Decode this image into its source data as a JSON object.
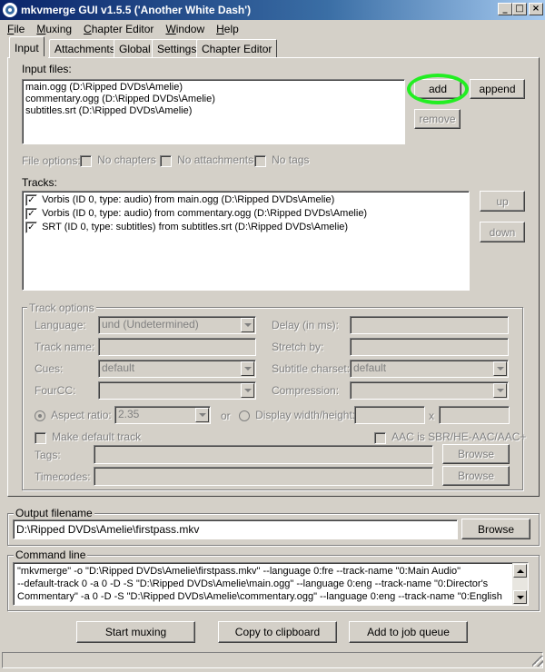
{
  "window": {
    "title": "mkvmerge GUI v1.5.5 ('Another White Dash')",
    "minimize_glyph": "_",
    "maximize_glyph": "□",
    "close_glyph": "×"
  },
  "menu": [
    "File",
    "Muxing",
    "Chapter Editor",
    "Window",
    "Help"
  ],
  "menu_accel": [
    "F",
    "M",
    "C",
    "W",
    "H"
  ],
  "tabs": [
    "Input",
    "Attachments",
    "Global",
    "Settings",
    "Chapter Editor"
  ],
  "active_tab": "Input",
  "input_files": {
    "label": "Input files:",
    "items": [
      "main.ogg (D:\\Ripped DVDs\\Amelie)",
      "commentary.ogg (D:\\Ripped DVDs\\Amelie)",
      "subtitles.srt (D:\\Ripped DVDs\\Amelie)"
    ],
    "add_label": "add",
    "append_label": "append",
    "remove_label": "remove"
  },
  "file_options": {
    "label": "File options:",
    "no_chapters": "No chapters",
    "no_attachments": "No attachments",
    "no_tags": "No tags"
  },
  "tracks": {
    "label": "Tracks:",
    "items": [
      {
        "checked": true,
        "text": "Vorbis (ID 0, type: audio) from main.ogg (D:\\Ripped DVDs\\Amelie)"
      },
      {
        "checked": true,
        "text": "Vorbis (ID 0, type: audio) from commentary.ogg (D:\\Ripped DVDs\\Amelie)"
      },
      {
        "checked": true,
        "text": "SRT (ID 0, type: subtitles) from subtitles.srt (D:\\Ripped DVDs\\Amelie)"
      }
    ],
    "up_label": "up",
    "down_label": "down"
  },
  "track_options": {
    "title": "Track options",
    "language_label": "Language:",
    "language_value": "und (Undetermined)",
    "delay_label": "Delay (in ms):",
    "track_name_label": "Track name:",
    "stretch_label": "Stretch by:",
    "cues_label": "Cues:",
    "cues_value": "default",
    "subtitle_charset_label": "Subtitle charset:",
    "subtitle_charset_value": "default",
    "fourcc_label": "FourCC:",
    "compression_label": "Compression:",
    "aspect_ratio_label": "Aspect ratio:",
    "aspect_ratio_value": "2.35",
    "or_label": "or",
    "display_wh_label": "Display width/height:",
    "x_label": "x",
    "make_default_label": "Make default track",
    "aac_label": "AAC is SBR/HE-AAC/AAC+",
    "tags_label": "Tags:",
    "timecodes_label": "Timecodes:",
    "browse_label": "Browse"
  },
  "output": {
    "title": "Output filename",
    "value": "D:\\Ripped DVDs\\Amelie\\firstpass.mkv",
    "browse_label": "Browse"
  },
  "command_line": {
    "title": "Command line",
    "lines": [
      "\"mkvmerge\" -o \"D:\\Ripped DVDs\\Amelie\\firstpass.mkv\"  --language 0:fre --track-name \"0:Main Audio\"",
      "--default-track 0 -a 0 -D -S \"D:\\Ripped DVDs\\Amelie\\main.ogg\" --language 0:eng --track-name \"0:Director's",
      "Commentary\" -a 0 -D -S \"D:\\Ripped DVDs\\Amelie\\commentary.ogg\" --language 0:eng --track-name \"0:English"
    ]
  },
  "actions": {
    "start_muxing": "Start muxing",
    "copy_clipboard": "Copy to clipboard",
    "add_job_queue": "Add to job queue"
  },
  "colors": {
    "titlebar_start": "#0a246a",
    "titlebar_end": "#a6caf0",
    "face": "#d4d0c8",
    "highlight_ring": "#22ee22"
  }
}
